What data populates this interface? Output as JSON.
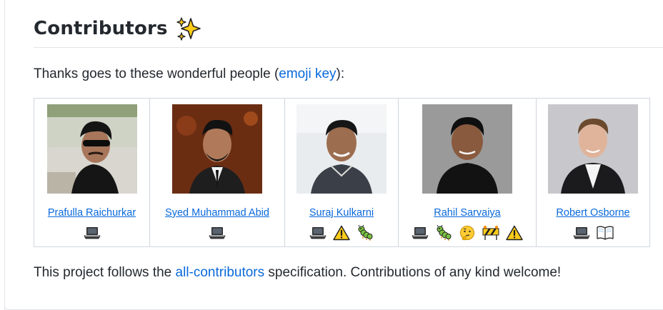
{
  "heading": {
    "title": "Contributors",
    "emoji": "sparkles-icon"
  },
  "intro": {
    "before": "Thanks goes to these wonderful people (",
    "link": "emoji key",
    "after": "):"
  },
  "contributors": [
    {
      "name": "Prafulla Raichurkar",
      "types": [
        "laptop-icon"
      ]
    },
    {
      "name": "Syed Muhammad Abid",
      "types": [
        "laptop-icon"
      ]
    },
    {
      "name": "Suraj Kulkarni",
      "types": [
        "laptop-icon",
        "warning-icon",
        "bug-icon"
      ]
    },
    {
      "name": "Rahil Sarvaiya",
      "types": [
        "laptop-icon",
        "bug-icon",
        "thinking-face-icon",
        "construction-icon",
        "warning-icon"
      ]
    },
    {
      "name": "Robert Osborne",
      "types": [
        "laptop-icon",
        "open-book-icon"
      ]
    }
  ],
  "footer": {
    "before": "This project follows the ",
    "link": "all-contributors",
    "after": " specification. Contributions of any kind welcome!"
  },
  "colors": {
    "link": "#0969da",
    "text": "#24292f",
    "border": "#d0d7de"
  }
}
